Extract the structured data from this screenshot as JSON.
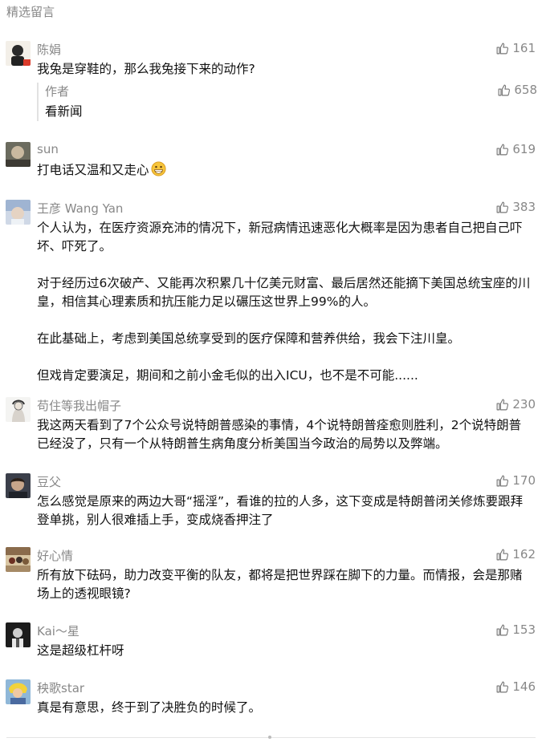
{
  "header": {
    "title": "精选留言"
  },
  "comments": [
    {
      "name": "陈娟",
      "likes": "161",
      "paras": [
        "我兔是穿鞋的，那么我兔接下来的动作?"
      ],
      "reply": {
        "label": "作者",
        "text": "看新闻",
        "likes": "658"
      }
    },
    {
      "name": "sun",
      "likes": "619",
      "paras": [
        "打电话又温和又走心"
      ],
      "emoji": "grinning-face-emoji"
    },
    {
      "name": "王彦 Wang Yan",
      "likes": "383",
      "paras": [
        "个人认为，在医疗资源充沛的情况下，新冠病情迅速恶化大概率是因为患者自己把自己吓坏、吓死了。",
        "对于经历过6次破产、又能再次积累几十亿美元财富、最后居然还能摘下美国总统宝座的川皇，相信其心理素质和抗压能力足以碾压这世界上99%的人。",
        "在此基础上，考虑到美国总统享受到的医疗保障和营养供给，我会下注川皇。",
        "但戏肯定要演足，期间和之前小金毛似的出入ICU，也不是不可能......"
      ]
    },
    {
      "name": "苟住等我出帽子",
      "likes": "230",
      "paras": [
        "我这两天看到了7个公众号说特朗普感染的事情，4个说特朗普痊愈则胜利，2个说特朗普已经没了，只有一个从特朗普生病角度分析美国当今政治的局势以及弊端。"
      ]
    },
    {
      "name": "豆父",
      "likes": "170",
      "paras": [
        "怎么感觉是原来的两边大哥“摇淫”，看谁的拉的人多，这下变成是特朗普闭关修炼要跟拜登单挑，别人很难插上手，变成烧香押注了"
      ]
    },
    {
      "name": "好心情",
      "likes": "162",
      "paras": [
        "所有放下砝码，助力改变平衡的队友，都将是把世界踩在脚下的力量。而情报，会是那赌场上的透视眼镜?"
      ]
    },
    {
      "name": "Kai～星",
      "likes": "153",
      "paras": [
        "这是超级杠杆呀"
      ]
    },
    {
      "name": "秧歌star",
      "likes": "146",
      "paras": [
        "真是有意思，终于到了决胜负的时候了。"
      ]
    }
  ]
}
